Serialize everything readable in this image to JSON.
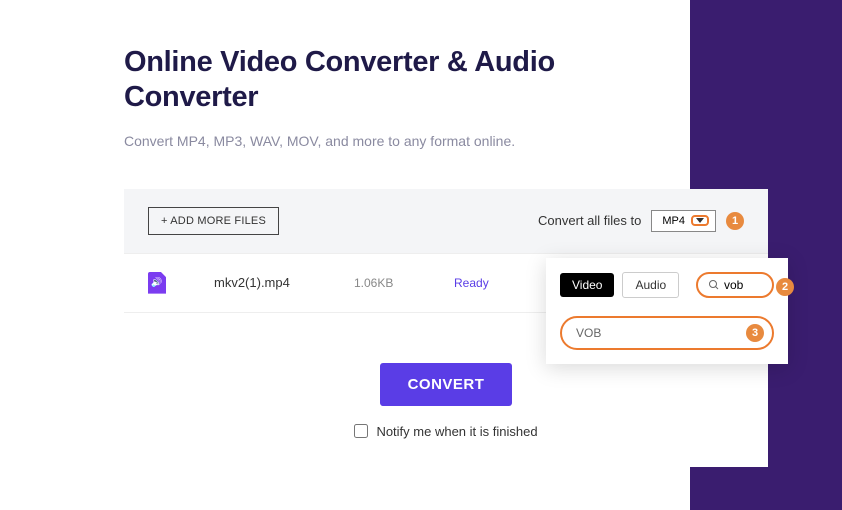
{
  "title": "Online Video Converter & Audio Converter",
  "subtitle": "Convert MP4, MP3, WAV, MOV, and more to any format online.",
  "toolbar": {
    "add_more_label": "+ ADD MORE FILES",
    "convert_all_label": "Convert all files to",
    "selected_format": "MP4"
  },
  "file": {
    "name": "mkv2(1).mp4",
    "size": "1.06KB",
    "status": "Ready"
  },
  "convert_button": "CONVERT",
  "notify_label": "Notify me when it is finished",
  "dropdown": {
    "tab_video": "Video",
    "tab_audio": "Audio",
    "search_value": "vob",
    "option_vob": "VOB"
  },
  "annotations": {
    "a1": "1",
    "a2": "2",
    "a3": "3"
  }
}
